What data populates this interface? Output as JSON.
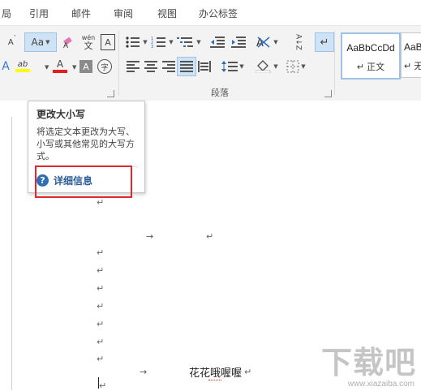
{
  "tabs": [
    "局",
    "引用",
    "邮件",
    "审阅",
    "视图",
    "办公标签"
  ],
  "font_group": {
    "grow_font_label": "A",
    "change_case_label": "Aa",
    "phonetic_label": "wén",
    "phonetic_glyph": "文",
    "char_border_label": "A",
    "text_effect_label": "A",
    "highlight_label": "ab",
    "font_color_label": "A",
    "char_shading_label": "A",
    "enclose_char_label": "字"
  },
  "paragraph_group": {
    "label": "段落",
    "sort_label": "A↓Z",
    "show_marks_label": "↵"
  },
  "styles_group": {
    "styles": [
      {
        "sample": "AaBbCcDd",
        "name": "↵ 正文"
      },
      {
        "sample": "AaB",
        "name": "↵ 无"
      }
    ]
  },
  "tooltip": {
    "title": "更改大小写",
    "description": "将选定文本更改为大写、小写或其他常见的大写方式。",
    "help_label": "详细信息"
  },
  "document": {
    "para_mark": "↵",
    "tab_arrow": "→",
    "body_text": "花花哦喔喔"
  },
  "watermark": {
    "text": "下载吧",
    "url": "www.xiazaiba.com"
  },
  "colors": {
    "highlight_box": "#e0282e",
    "help_icon": "#2f6db5",
    "highlighter_yellow": "#ffff00",
    "font_color_red": "#e02020"
  }
}
